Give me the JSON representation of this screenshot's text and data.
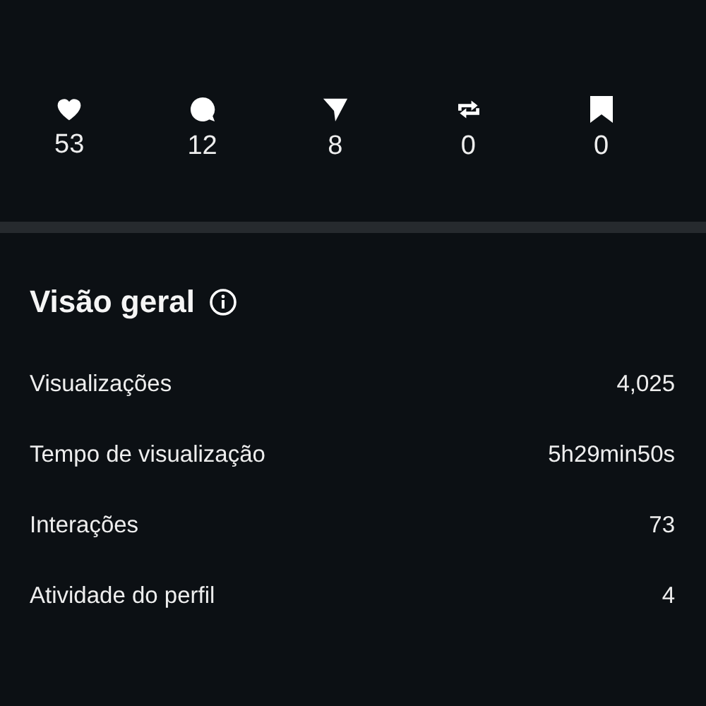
{
  "stats": [
    {
      "kind": "like",
      "count": "53"
    },
    {
      "kind": "comment",
      "count": "12"
    },
    {
      "kind": "share",
      "count": "8"
    },
    {
      "kind": "repost",
      "count": "0"
    },
    {
      "kind": "save",
      "count": "0"
    }
  ],
  "overview": {
    "title": "Visão geral",
    "rows": [
      {
        "label": "Visualizações",
        "value": "4,025"
      },
      {
        "label": "Tempo de visualização",
        "value": "5h29min50s"
      },
      {
        "label": "Interações",
        "value": "73"
      },
      {
        "label": "Atividade do perfil",
        "value": "4"
      }
    ]
  }
}
